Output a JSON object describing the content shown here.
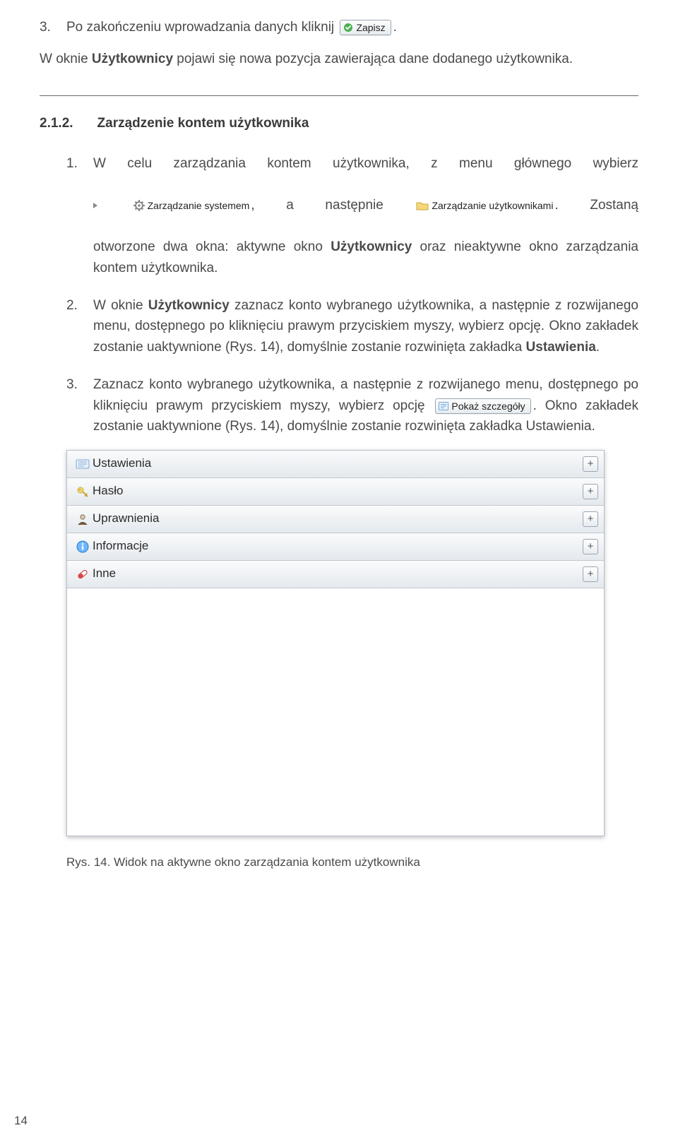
{
  "step3": {
    "num": "3.",
    "lead": "Po zakończeniu wprowadzania danych kliknij",
    "btn_label": "Zapisz",
    "tail": "."
  },
  "after3": {
    "pre": "W oknie ",
    "bold": "Użytkownicy",
    "post": " pojawi się nowa pozycja zawierająca dane dodanego użytkownika."
  },
  "section": {
    "num": "2.1.2.",
    "title": "Zarządzenie kontem użytkownika"
  },
  "s1": {
    "num": "1.",
    "l1": "W celu zarządzania kontem użytkownika, z menu głównego wybierz",
    "chip1": "Zarządzanie systemem",
    "mid": ",   a   następnie",
    "chip2": "Zarządzanie użytkownikami",
    "after_dot": ". Zostaną",
    "l3a": "otworzone dwa okna: aktywne okno ",
    "l3b": "Użytkownicy",
    "l3c": " oraz nieaktywne okno zarządzania kontem użytkownika."
  },
  "s2": {
    "num": "2.",
    "a": "W oknie ",
    "b": "Użytkownicy",
    "c": " zaznacz konto wybranego użytkownika, a następnie z rozwijanego menu, dostępnego po kliknięciu prawym przyciskiem myszy, wybierz opcję. Okno zakładek zostanie uaktywnione (Rys. 14), domyślnie zostanie rozwinięta zakładka ",
    "d": "Ustawienia",
    "e": "."
  },
  "s3": {
    "num": "3.",
    "a": "Zaznacz konto wybranego użytkownika, a następnie z rozwijanego menu, dostępnego po kliknięciu prawym przyciskiem myszy, wybierz opcję ",
    "btn": "Pokaż szczegóły",
    "b": ". Okno zakładek zostanie uaktywnione (Rys. 14), domyślnie zostanie rozwinięta zakładka Ustawienia."
  },
  "accordion": {
    "items": [
      {
        "label": "Ustawienia",
        "icon": "settings"
      },
      {
        "label": "Hasło",
        "icon": "key"
      },
      {
        "label": "Uprawnienia",
        "icon": "user"
      },
      {
        "label": "Informacje",
        "icon": "info"
      },
      {
        "label": "Inne",
        "icon": "pill"
      }
    ]
  },
  "figure": {
    "label": "Rys.  14.",
    "caption": " Widok na aktywne okno zarządzania kontem użytkownika"
  },
  "page_number": "14"
}
